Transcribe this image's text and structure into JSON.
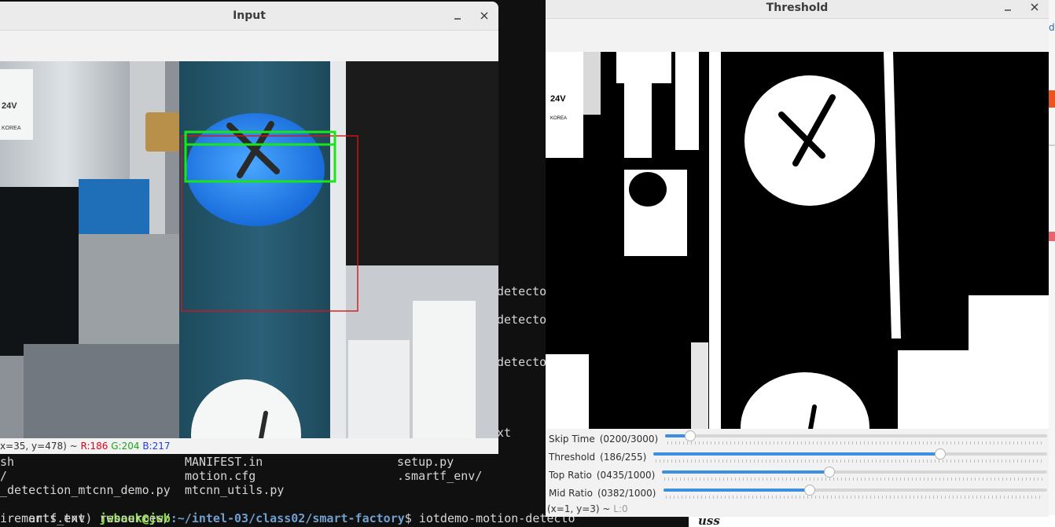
{
  "terminal": {
    "rows": [
      {
        "c1": "sh",
        "c2": "MANIFEST.in",
        "c3": "setup.py"
      },
      {
        "c1": "/",
        "c2": "motion.cfg",
        "c3": ".smartf_env/"
      },
      {
        "c1": "_detection_mtcnn_demo.py",
        "c2": "mtcnn_utils.py",
        "c3": ""
      }
    ],
    "prompt_prefix": "artf_env) ",
    "prompt_user": "jwbaek@jwb",
    "prompt_path": ":~/intel-03/class02/smart-factory",
    "prompt_command": "$ iotdemo-motion-detecto",
    "last_row": "irements.txt  resources/",
    "peek_lines": [
      "detecto",
      "detecto",
      "detecto",
      "xt"
    ]
  },
  "background_app": {
    "footer_text": "uss"
  },
  "input_window": {
    "title": "Input",
    "status": {
      "coords": "x=35, y=478) ~ ",
      "r": "R:186",
      "g": "G:204",
      "b": "B:217"
    }
  },
  "threshold_window": {
    "title": "Threshold",
    "trackbars": [
      {
        "name": "Skip Time",
        "value_text": "(0200/3000)",
        "fraction": 0.0667
      },
      {
        "name": "Threshold",
        "value_text": "(186/255)",
        "fraction": 0.7294
      },
      {
        "name": "Top Ratio",
        "value_text": "(0435/1000)",
        "fraction": 0.435
      },
      {
        "name": "Mid Ratio",
        "value_text": "(0382/1000)",
        "fraction": 0.382
      }
    ],
    "status": {
      "coords": "(x=1, y=3) ~ ",
      "level": "L:0"
    }
  },
  "icons": {
    "minimize": "minimize-icon",
    "close": "close-icon"
  },
  "colors": {
    "detect_green": "#19e619",
    "roi_red": "#d01818",
    "slider_blue": "#3d8fe0"
  }
}
